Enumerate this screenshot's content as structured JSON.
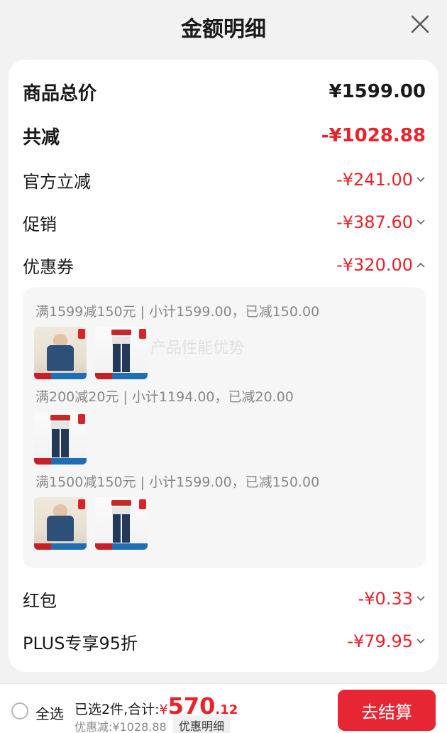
{
  "header": {
    "title": "金额明细"
  },
  "summary": {
    "total_label": "商品总价",
    "total_value": "¥1599.00",
    "reduce_label": "共减",
    "reduce_value": "-¥1028.88"
  },
  "items": [
    {
      "label": "官方立减",
      "value": "-¥241.00",
      "expanded": false
    },
    {
      "label": "促销",
      "value": "-¥387.60",
      "expanded": false
    },
    {
      "label": "优惠券",
      "value": "-¥320.00",
      "expanded": true
    }
  ],
  "coupon_rules": [
    {
      "text": "满1599减150元 | 小计1599.00，已减150.00",
      "products": [
        "shirt",
        "jeans"
      ]
    },
    {
      "text": "满200减20元 | 小计1194.00，已减20.00",
      "products": [
        "jeans"
      ]
    },
    {
      "text": "满1500减150元 | 小计1599.00，已减150.00",
      "products": [
        "shirt",
        "jeans"
      ]
    }
  ],
  "watermark": "产品性能优势",
  "more_items": [
    {
      "label": "红包",
      "value": "-¥0.33",
      "expanded": false
    },
    {
      "label": "PLUS专享95折",
      "value": "-¥79.95",
      "expanded": false
    }
  ],
  "footer": {
    "select_all": "全选",
    "selected_text": "已选2件,合计:",
    "currency": "¥",
    "total_int": "570",
    "total_dec": ".12",
    "discount_text": "优惠减:¥1028.88",
    "detail_button": "优惠明细",
    "checkout_button": "去结算"
  },
  "colors": {
    "accent": "#e62632",
    "discount_text": "#e8232b",
    "background": "#f2f2f2"
  }
}
